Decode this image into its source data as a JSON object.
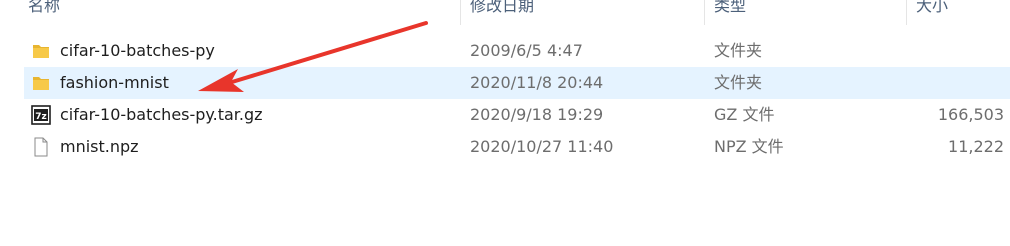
{
  "columns": {
    "name": "名称",
    "date": "修改日期",
    "type": "类型",
    "size": "大小"
  },
  "files": [
    {
      "name": "cifar-10-batches-py",
      "date": "2009/6/5 4:47",
      "type": "文件夹",
      "size": "",
      "icon": "folder-icon"
    },
    {
      "name": "fashion-mnist",
      "date": "2020/11/8 20:44",
      "type": "文件夹",
      "size": "",
      "icon": "folder-icon"
    },
    {
      "name": "cifar-10-batches-py.tar.gz",
      "date": "2020/9/18 19:29",
      "type": "GZ 文件",
      "size": "166,503",
      "icon": "7z-archive-icon"
    },
    {
      "name": "mnist.npz",
      "date": "2020/10/27 11:40",
      "type": "NPZ 文件",
      "size": "11,222",
      "icon": "file-icon"
    }
  ],
  "selected_row": 1,
  "colors": {
    "selection": "#e5f3ff",
    "arrow": "#e8352b",
    "folder": "#f7c948"
  }
}
